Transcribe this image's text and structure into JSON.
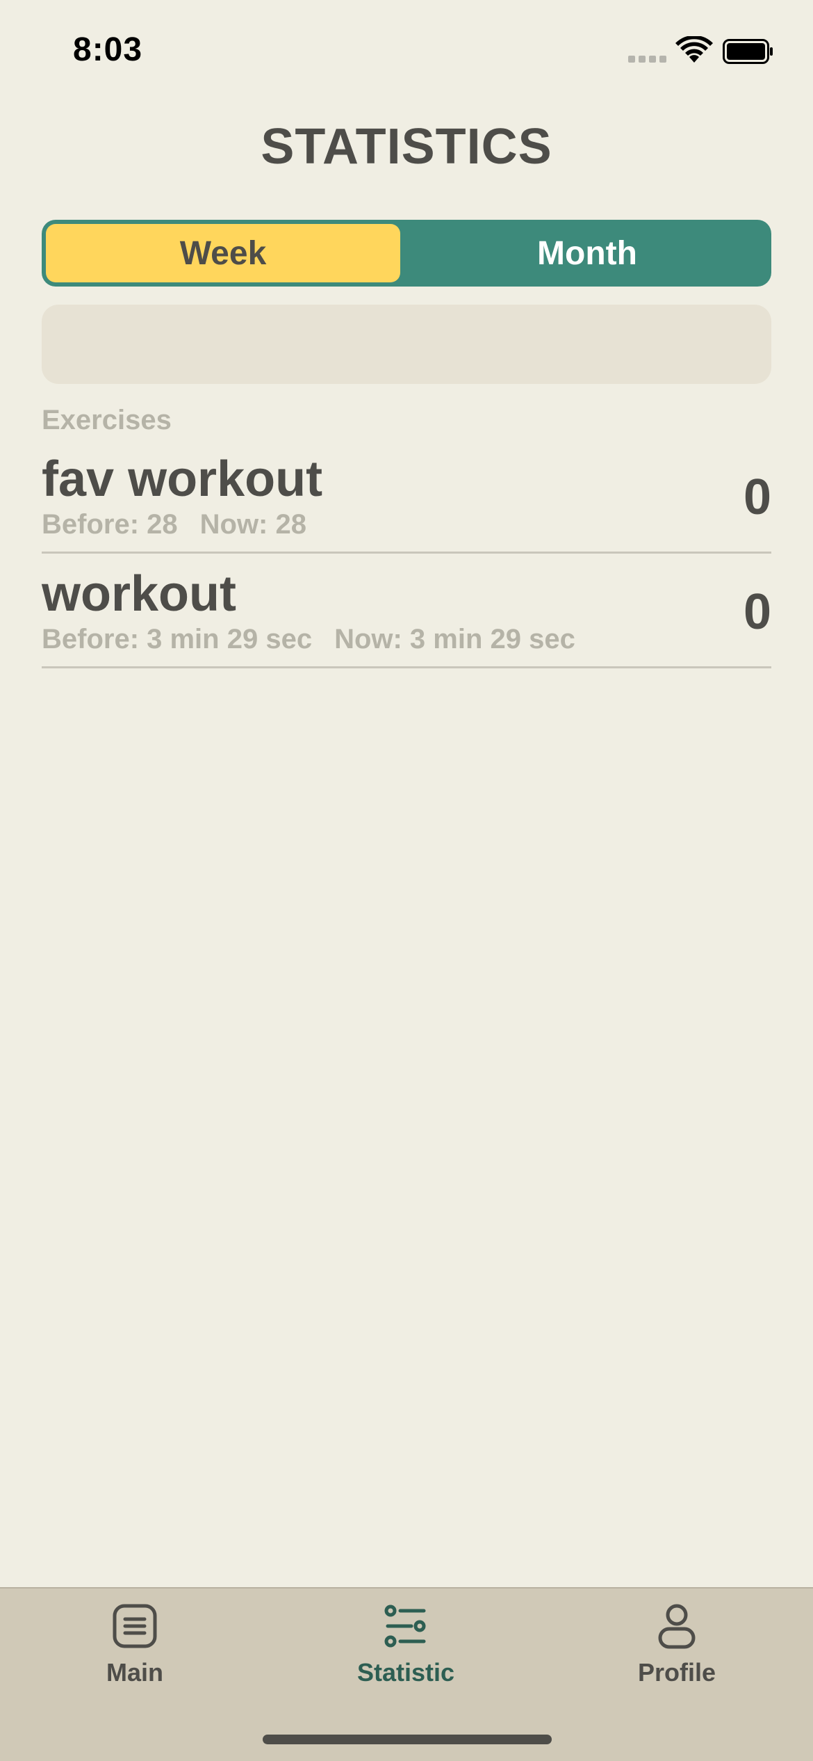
{
  "status_bar": {
    "time": "8:03",
    "icons": [
      "signal-icon",
      "wifi-icon",
      "battery-icon"
    ]
  },
  "title": "STATISTICS",
  "period_toggle": {
    "options": [
      "Week",
      "Month"
    ],
    "selected": "Week"
  },
  "exercises": {
    "section_label": "Exercises",
    "items": [
      {
        "name": "fav workout",
        "before": "Before: 28",
        "now": "Now: 28",
        "count": "0"
      },
      {
        "name": "workout",
        "before": "Before: 3 min 29 sec",
        "now": "Now: 3 min 29 sec",
        "count": "0"
      }
    ]
  },
  "tab_bar": {
    "tabs": [
      {
        "label": "Main",
        "icon": "list-icon"
      },
      {
        "label": "Statistic",
        "icon": "sliders-icon"
      },
      {
        "label": "Profile",
        "icon": "person-icon"
      }
    ],
    "active": "Statistic"
  },
  "colors": {
    "background": "#F0EEE3",
    "accent_teal": "#3D8A7B",
    "accent_yellow": "#FFD65C",
    "tab_bar": "#D0C9B7",
    "text": "#4E4D49",
    "muted_text": "#B5B3A7"
  }
}
